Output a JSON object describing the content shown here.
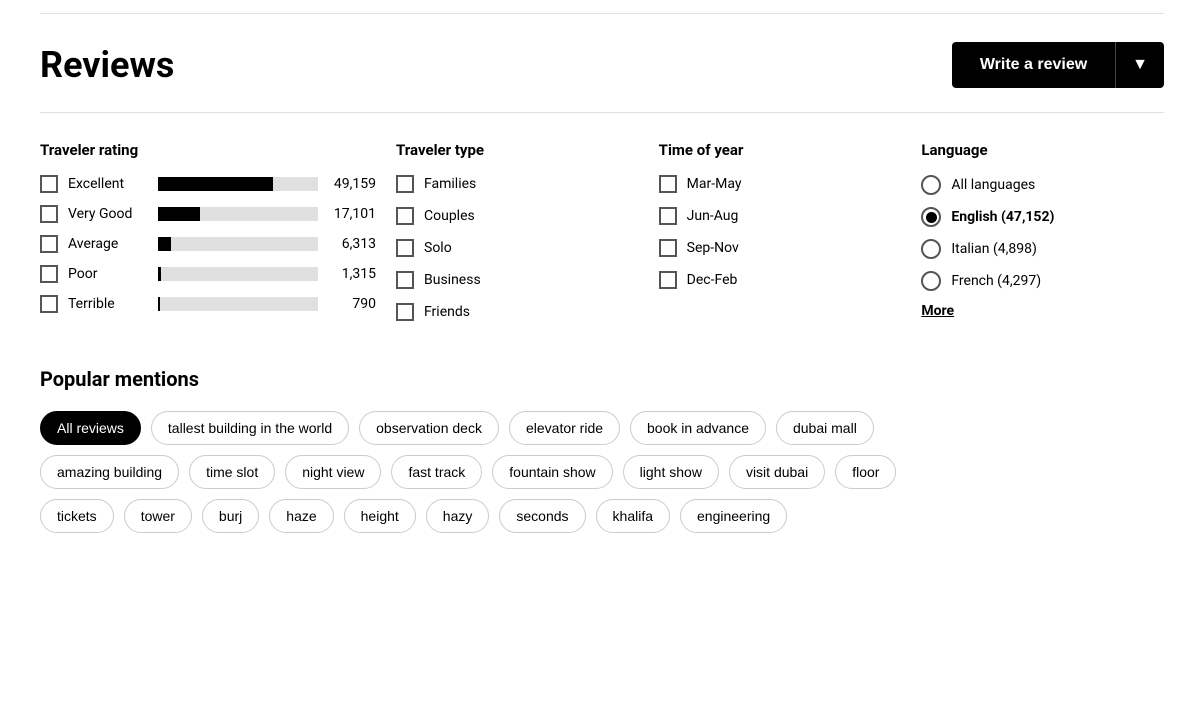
{
  "header": {
    "title": "Reviews",
    "write_review_label": "Write a review",
    "dropdown_icon": "▼"
  },
  "traveler_rating": {
    "title": "Traveler rating",
    "items": [
      {
        "label": "Excellent",
        "count": "49,159",
        "bar_pct": 72
      },
      {
        "label": "Very Good",
        "count": "17,101",
        "bar_pct": 26
      },
      {
        "label": "Average",
        "count": "6,313",
        "bar_pct": 8
      },
      {
        "label": "Poor",
        "count": "1,315",
        "bar_pct": 2
      },
      {
        "label": "Terrible",
        "count": "790",
        "bar_pct": 1
      }
    ]
  },
  "traveler_type": {
    "title": "Traveler type",
    "items": [
      {
        "label": "Families"
      },
      {
        "label": "Couples"
      },
      {
        "label": "Solo"
      },
      {
        "label": "Business"
      },
      {
        "label": "Friends"
      }
    ]
  },
  "time_of_year": {
    "title": "Time of year",
    "items": [
      {
        "label": "Mar-May"
      },
      {
        "label": "Jun-Aug"
      },
      {
        "label": "Sep-Nov"
      },
      {
        "label": "Dec-Feb"
      }
    ]
  },
  "language": {
    "title": "Language",
    "items": [
      {
        "label": "All languages",
        "selected": false
      },
      {
        "label": "English (47,152)",
        "selected": true
      },
      {
        "label": "Italian (4,898)",
        "selected": false
      },
      {
        "label": "French (4,297)",
        "selected": false
      }
    ],
    "more_label": "More"
  },
  "popular_mentions": {
    "title": "Popular mentions",
    "tags_row1": [
      {
        "label": "All reviews",
        "active": true
      },
      {
        "label": "tallest building in the world",
        "active": false
      },
      {
        "label": "observation deck",
        "active": false
      },
      {
        "label": "elevator ride",
        "active": false
      },
      {
        "label": "book in advance",
        "active": false
      },
      {
        "label": "dubai mall",
        "active": false
      }
    ],
    "tags_row2": [
      {
        "label": "amazing building",
        "active": false
      },
      {
        "label": "time slot",
        "active": false
      },
      {
        "label": "night view",
        "active": false
      },
      {
        "label": "fast track",
        "active": false
      },
      {
        "label": "fountain show",
        "active": false
      },
      {
        "label": "light show",
        "active": false
      },
      {
        "label": "visit dubai",
        "active": false
      },
      {
        "label": "floor",
        "active": false
      }
    ],
    "tags_row3": [
      {
        "label": "tickets",
        "active": false
      },
      {
        "label": "tower",
        "active": false
      },
      {
        "label": "burj",
        "active": false
      },
      {
        "label": "haze",
        "active": false
      },
      {
        "label": "height",
        "active": false
      },
      {
        "label": "hazy",
        "active": false
      },
      {
        "label": "seconds",
        "active": false
      },
      {
        "label": "khalifa",
        "active": false
      },
      {
        "label": "engineering",
        "active": false
      }
    ]
  }
}
